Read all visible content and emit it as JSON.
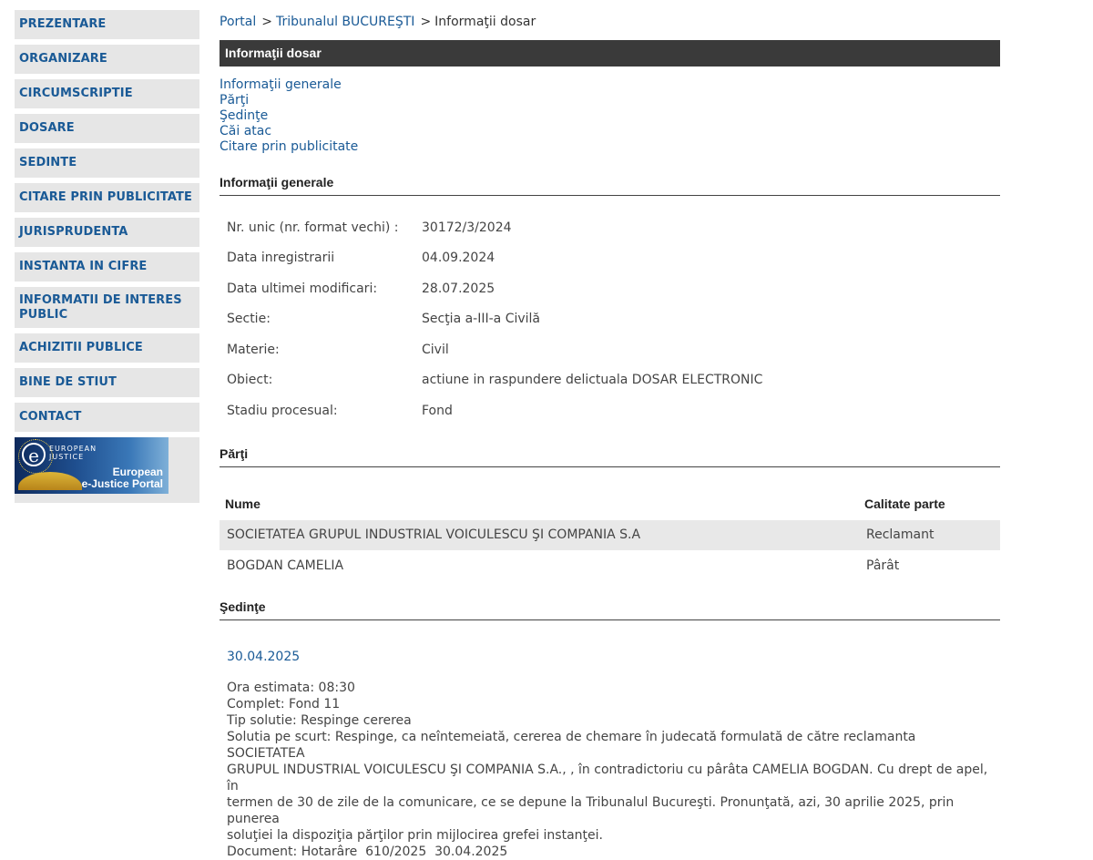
{
  "sidebar": {
    "items": [
      {
        "label": "PREZENTARE"
      },
      {
        "label": "ORGANIZARE"
      },
      {
        "label": "CIRCUMSCRIPTIE"
      },
      {
        "label": "DOSARE"
      },
      {
        "label": "SEDINTE"
      },
      {
        "label": "CITARE PRIN PUBLICITATE"
      },
      {
        "label": "JURISPRUDENTA"
      },
      {
        "label": "INSTANTA IN CIFRE"
      },
      {
        "label": "INFORMATII DE INTERES PUBLIC"
      },
      {
        "label": "ACHIZITII PUBLICE"
      },
      {
        "label": "BINE DE STIUT"
      },
      {
        "label": "CONTACT"
      }
    ],
    "banner": {
      "small_text_1": "EUROPEAN",
      "small_text_2": "JUSTICE",
      "title_line1": "European",
      "title_line2": "e-Justice Portal"
    }
  },
  "breadcrumb": {
    "portal": "Portal",
    "sep1": ">",
    "court": "Tribunalul BUCUREŞTI",
    "sep2": ">",
    "current": "Informaţii dosar"
  },
  "page_title": "Informaţii dosar",
  "anchors": {
    "general": "Informaţii generale",
    "parti": "Părţi",
    "sedinte": "Şedinţe",
    "cai_atac": "Căi atac",
    "citare": "Citare prin publicitate"
  },
  "general": {
    "heading": "Informaţii generale",
    "rows": [
      {
        "label": "Nr. unic (nr. format vechi) :",
        "value": "30172/3/2024"
      },
      {
        "label": "Data inregistrarii",
        "value": "04.09.2024"
      },
      {
        "label": "Data ultimei modificari:",
        "value": "28.07.2025"
      },
      {
        "label": "Sectie:",
        "value": "Secţia a-III-a Civilă"
      },
      {
        "label": "Materie:",
        "value": "Civil"
      },
      {
        "label": "Obiect:",
        "value": "actiune in raspundere delictuala DOSAR ELECTRONIC"
      },
      {
        "label": "Stadiu procesual:",
        "value": "Fond"
      }
    ]
  },
  "parti": {
    "heading": "Părţi",
    "col_name": "Nume",
    "col_role": "Calitate parte",
    "rows": [
      {
        "name": "SOCIETATEA GRUPUL INDUSTRIAL VOICULESCU ŞI COMPANIA S.A",
        "role": "Reclamant"
      },
      {
        "name": "BOGDAN CAMELIA",
        "role": "Pârât"
      }
    ]
  },
  "sedinte": {
    "heading": "Şedinţe",
    "date": "30.04.2025",
    "ora": "Ora estimata: 08:30",
    "complet": "Complet: Fond 11",
    "tip": "Tip solutie: Respinge cererea",
    "solutie_line1": "Solutia pe scurt: Respinge, ca neîntemeiată, cererea de chemare în judecată formulată de către reclamanta SOCIETATEA",
    "solutie_line2": "GRUPUL INDUSTRIAL VOICULESCU ŞI COMPANIA S.A., , în contradictoriu cu pârâta CAMELIA BOGDAN. Cu drept de apel, în",
    "solutie_line3": "termen de 30 de zile de la comunicare, ce se depune la Tribunalul Bucureşti. Pronunţată, azi, 30 aprilie 2025, prin punerea",
    "solutie_line4": "soluţiei la dispoziţia părţilor prin mijlocirea grefei instanţei.",
    "document": "Document: Hotarâre  610/2025  30.04.2025"
  }
}
